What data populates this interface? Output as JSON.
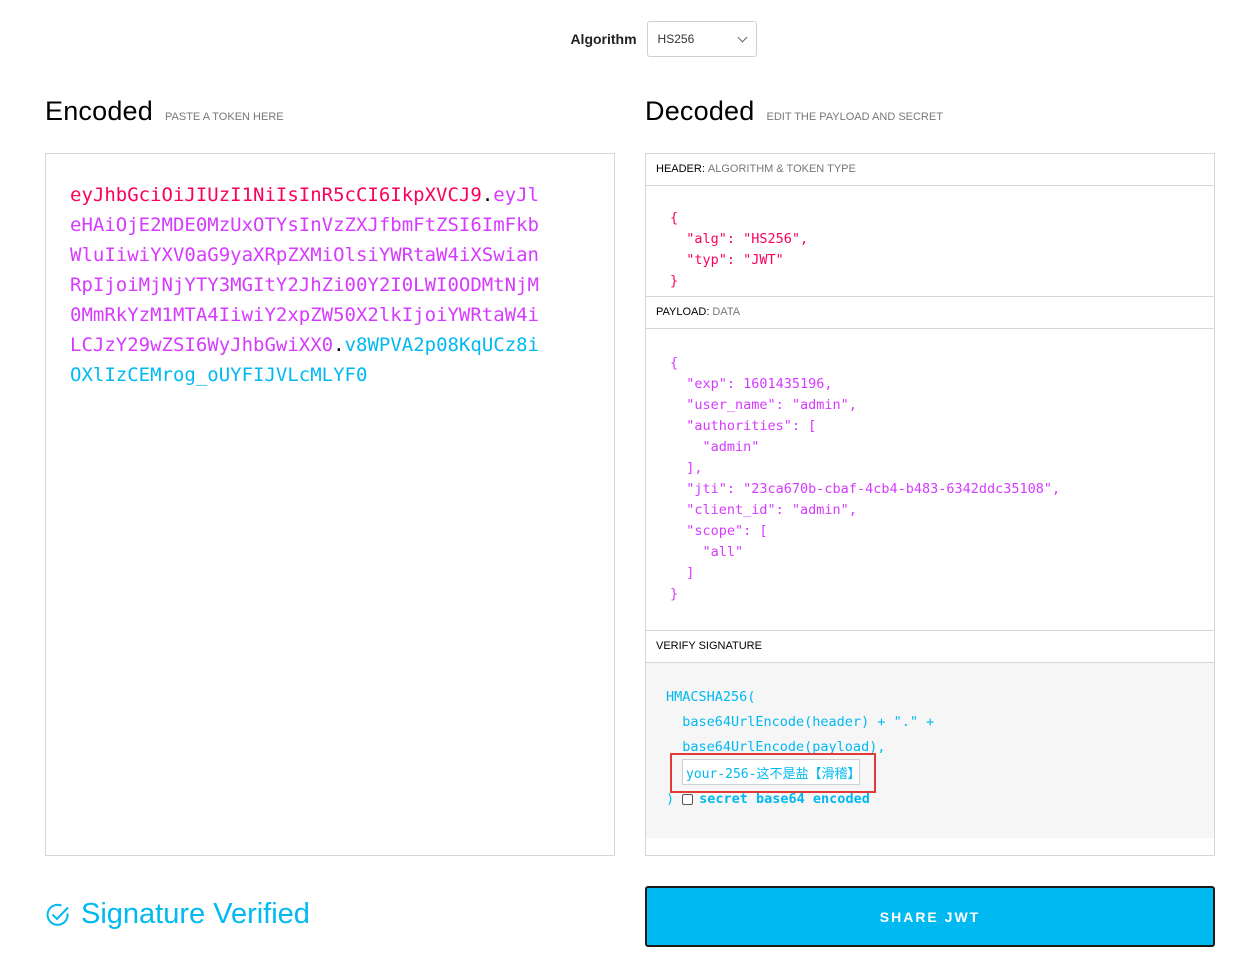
{
  "algorithm": {
    "label": "Algorithm",
    "selected": "HS256"
  },
  "encoded": {
    "title": "Encoded",
    "hint": "PASTE A TOKEN HERE",
    "token": {
      "header": "eyJhbGciOiJIUzI1NiIsInR5cCI6IkpXVCJ9",
      "dot1": ".",
      "payload": "eyJleHAiOjE2MDE0MzUxOTYsInVzZXJfbmFtZSI6ImFkbWluIiwiYXV0aG9yaXRpZXMiOlsiYWRtaW4iXSwianRpIjoiMjNjYTY3MGItY2JhZi00Y2I0LWI0ODMtNjM0MmRkYzM1MTA4IiwiY2xpZW50X2lkIjoiYWRtaW4iLCJzY29wZSI6WyJhbGwiXX0",
      "dot2": ".",
      "signature": "v8WPVA2p08KqUCz8iOXlIzCEMrog_oUYFIJVLcMLYF0"
    }
  },
  "decoded": {
    "title": "Decoded",
    "hint": "EDIT THE PAYLOAD AND SECRET",
    "header_section": {
      "title": "HEADER:",
      "subtitle": "ALGORITHM & TOKEN TYPE",
      "json": "{\n  \"alg\": \"HS256\",\n  \"typ\": \"JWT\"\n}"
    },
    "payload_section": {
      "title": "PAYLOAD:",
      "subtitle": "DATA",
      "json": "{\n  \"exp\": 1601435196,\n  \"user_name\": \"admin\",\n  \"authorities\": [\n    \"admin\"\n  ],\n  \"jti\": \"23ca670b-cbaf-4cb4-b483-6342ddc35108\",\n  \"client_id\": \"admin\",\n  \"scope\": [\n    \"all\"\n  ]\n}"
    },
    "verify_section": {
      "title": "VERIFY SIGNATURE",
      "line1": "HMACSHA256(",
      "line2": "  base64UrlEncode(header) + \".\" +",
      "line3": "  base64UrlEncode(payload),",
      "secret_value": "your-256-这不是盐【滑稽】",
      "close_paren": ")",
      "checkbox_label": "secret base64 encoded"
    }
  },
  "status": {
    "text": "Signature Verified"
  },
  "share_button": {
    "label": "SHARE JWT"
  }
}
